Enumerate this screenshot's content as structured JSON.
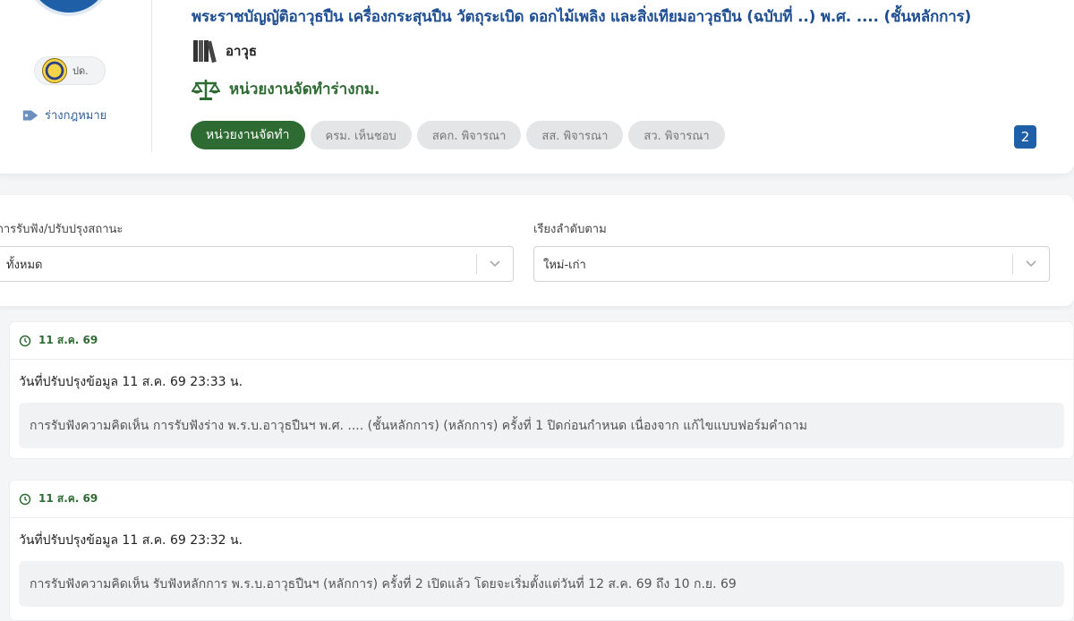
{
  "header": {
    "agency_label": "ปด.",
    "tag_label": "ร่างกฎหมาย",
    "title": "พระราชบัญญัติอาวุธปืน เครื่องกระสุนปืน วัตถุระเบิด ดอกไม้เพลิง และสิ่งเทียมอาวุธปืน (ฉบับที่ ..) พ.ศ. .... (ชั้นหลักการ)",
    "category": "อาวุธ",
    "unit": "หน่วยงานจัดทำร่างกม.",
    "steps": [
      {
        "label": "หน่วยงานจัดทำ",
        "active": true
      },
      {
        "label": "ครม. เห็นชอบ",
        "active": false
      },
      {
        "label": "สคก. พิจารณา",
        "active": false
      },
      {
        "label": "สส. พิจารณา",
        "active": false
      },
      {
        "label": "สว. พิจารณา",
        "active": false
      }
    ],
    "count": "2"
  },
  "filters": {
    "status_label": "การรับฟัง/ปรับปรุงสถานะ",
    "status_value": "ทั้งหมด",
    "sort_label": "เรียงลำดับตาม",
    "sort_value": "ใหม่-เก่า"
  },
  "entries": [
    {
      "date": "11 ส.ค. 69",
      "updated": "วันที่ปรับปรุงข้อมูล  11 ส.ค. 69 23:33 น.",
      "text": "การรับฟังความคิดเห็น การรับฟังร่าง พ.ร.บ.อาวุธปืนฯ พ.ศ. .... (ชั้นหลักการ) (หลักการ) ครั้งที่ 1 ปิดก่อนกำหนด เนื่องจาก แก้ไขแบบฟอร์มคำถาม"
    },
    {
      "date": "11 ส.ค. 69",
      "updated": "วันที่ปรับปรุงข้อมูล  11 ส.ค. 69 23:32 น.",
      "text": "การรับฟังความคิดเห็น รับฟังหลักการ พ.ร.บ.อาวุธปืนฯ (หลักการ) ครั้งที่ 2 เปิดแล้ว โดยจะเริ่มตั้งแต่วันที่ 12 ส.ค. 69 ถึง 10 ก.ย. 69"
    }
  ],
  "colors": {
    "primary_blue": "#1f4f93",
    "primary_green": "#2e6b33"
  }
}
